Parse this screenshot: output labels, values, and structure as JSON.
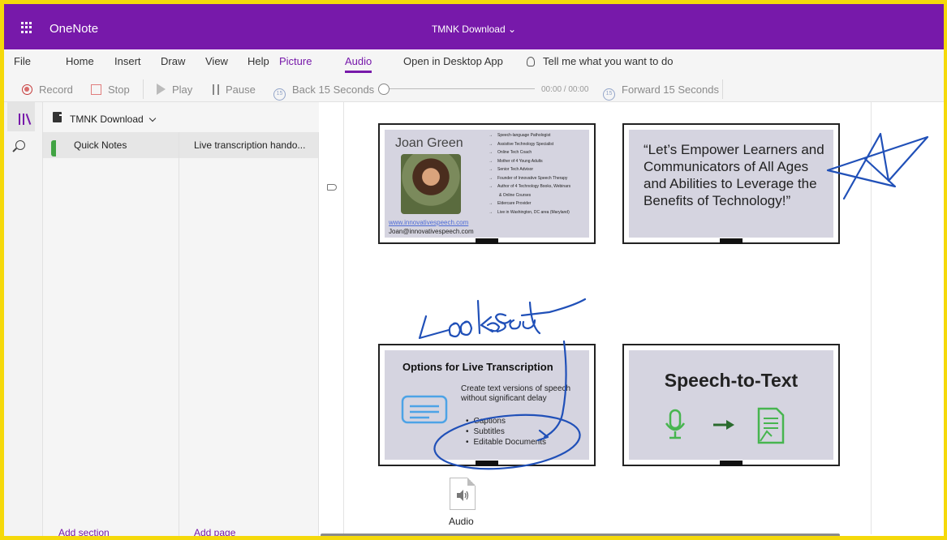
{
  "app": {
    "name": "OneNote",
    "doc_title": "TMNK Download ⌄"
  },
  "ribbon_tabs": [
    "File",
    "Home",
    "Insert",
    "Draw",
    "View",
    "Help",
    "Picture",
    "Audio",
    "Open in Desktop App",
    "Tell me what you want to do"
  ],
  "toolbar": {
    "record": "Record",
    "stop": "Stop",
    "play": "Play",
    "pause": "Pause",
    "back": "Back 15 Seconds",
    "time": "00:00 / 00:00",
    "forward": "Forward 15 Seconds",
    "seek_progress": 0
  },
  "notebook": {
    "name": "TMNK Download"
  },
  "sections": [
    {
      "label": "Quick Notes",
      "color": "#41a343"
    }
  ],
  "pages": [
    {
      "label": "Live transcription hando..."
    }
  ],
  "footer": {
    "add_section": "Add section",
    "add_page": "Add page"
  },
  "slides": {
    "s1": {
      "name": "Joan Green",
      "link": "www.innovativespeech.com",
      "email": "Joan@innovativespeech.com",
      "items": [
        "Speech-language Pathologist",
        "Assistive Technology Specialist",
        "Online Tech Coach",
        "Mother of 4 Young Adults",
        "Senior Tech Advisor",
        "Founder of Innovative Speech Therapy",
        "Author of 4 Technology Books, Webinars",
        "& Online Courses",
        "Eldercare Provider",
        "Live in Washington, DC area (Maryland)"
      ]
    },
    "s2": {
      "quote": "“Let’s Empower Learners and Communicators of All Ages and Abilities to Leverage the Benefits of Technology!”"
    },
    "s3": {
      "title": "Options for Live Transcription",
      "text": "Create text versions of speech without significant delay",
      "bullets": [
        "Captions",
        "Subtitles",
        "Editable Documents"
      ]
    },
    "s4": {
      "title": "Speech-to-Text"
    }
  },
  "handwriting": "Looks great",
  "audio_attachment": {
    "label": "Audio",
    "icon": "speaker-icon"
  },
  "colors": {
    "accent": "#7719aa",
    "ink": "#2050b8",
    "section": "#41a343"
  }
}
